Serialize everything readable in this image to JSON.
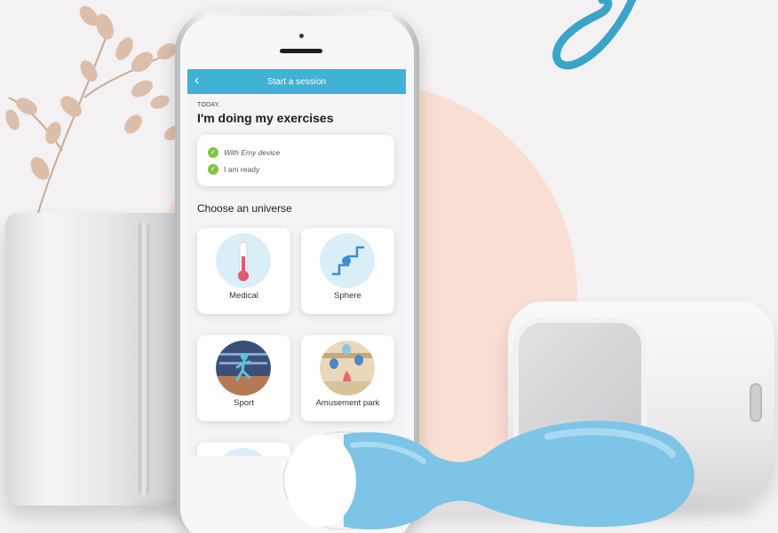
{
  "app": {
    "header_title": "Start a session",
    "today_label": "TODAY.",
    "page_title": "I'm doing my exercises",
    "checklist": [
      {
        "label": "With Emy device",
        "icon": "check-icon"
      },
      {
        "label": "I am ready",
        "icon": "check-icon"
      }
    ],
    "section_title": "Choose an universe",
    "universes": [
      {
        "label": "Medical",
        "icon": "thermometer-icon"
      },
      {
        "label": "Sphere",
        "icon": "stairs-icon"
      },
      {
        "label": "Sport",
        "icon": "runner-icon"
      },
      {
        "label": "Amusement park",
        "icon": "balloons-icon"
      }
    ]
  },
  "colors": {
    "header": "#40b2d2",
    "check": "#7fc544",
    "background_circle": "#f9dfd3",
    "device_blue": "#7ec4e6"
  }
}
